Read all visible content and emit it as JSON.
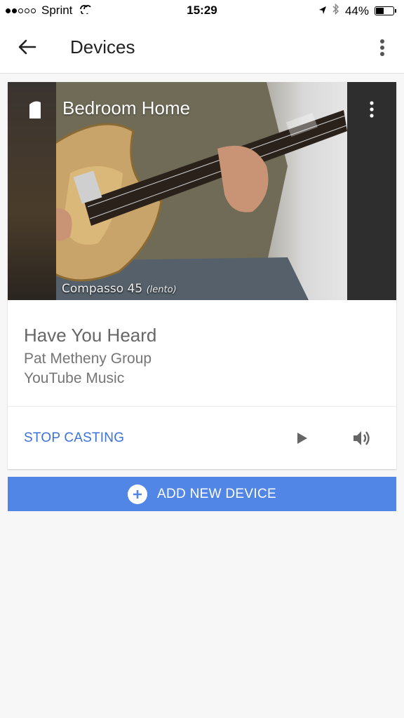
{
  "status_bar": {
    "carrier": "Sprint",
    "time": "15:29",
    "battery": "44%"
  },
  "app_bar": {
    "title": "Devices"
  },
  "device_card": {
    "device_name": "Bedroom Home",
    "video_caption": "Compasso 45",
    "video_caption_suffix": "(lento)",
    "song_title": "Have You Heard",
    "artist": "Pat Metheny Group",
    "source": "YouTube Music",
    "stop_label": "STOP CASTING"
  },
  "add_device": {
    "label": "ADD NEW DEVICE"
  },
  "colors": {
    "accent": "#3b73d9",
    "button_bg": "#5186e7"
  }
}
